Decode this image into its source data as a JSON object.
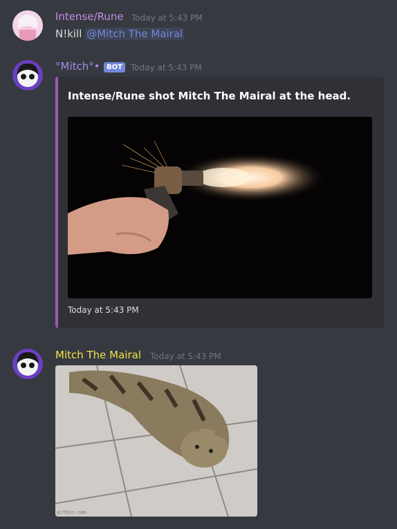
{
  "messages": [
    {
      "author": "Intense/Rune",
      "author_color": "#c38ee6",
      "timestamp": "Today at 5:43 PM",
      "content_prefix": "N!kill ",
      "mention": "@Mitch The Mairal"
    },
    {
      "author": "°Mitch°•",
      "author_color": "#a38ceb",
      "bot_tag": "BOT",
      "timestamp": "Today at 5:43 PM",
      "embed": {
        "accent_color": "#9b59b6",
        "title": "Intense/Rune shot Mitch The Mairal at the head.",
        "footer": "Today at 5:43 PM",
        "image_description": "hand firing revolver"
      }
    },
    {
      "author": "Mitch The Mairal",
      "author_color": "#f1e34a",
      "timestamp": "Today at 5:43 PM",
      "image": {
        "description": "cat lying on tiled floor",
        "watermark": "gifbin.com"
      }
    }
  ]
}
